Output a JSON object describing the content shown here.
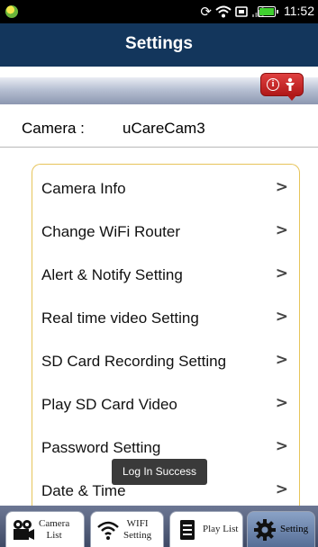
{
  "status_bar": {
    "time": "11:52",
    "icons": [
      "sync-icon",
      "wifi-icon",
      "screenshot-icon",
      "signal-icon",
      "battery-icon"
    ]
  },
  "header": {
    "title": "Settings"
  },
  "camera": {
    "label": "Camera :",
    "name": "uCareCam3"
  },
  "menu": {
    "items": [
      {
        "label": "Camera Info",
        "chevron": ">"
      },
      {
        "label": "Change WiFi Router",
        "chevron": ">"
      },
      {
        "label": "Alert & Notify Setting",
        "chevron": ">"
      },
      {
        "label": "Real time video Setting",
        "chevron": ">"
      },
      {
        "label": "SD Card Recording Setting",
        "chevron": ">"
      },
      {
        "label": "Play SD Card Video",
        "chevron": ">"
      },
      {
        "label": "Password Setting",
        "chevron": ">"
      },
      {
        "label": "Date & Time",
        "chevron": ">"
      }
    ]
  },
  "toast": {
    "text": "Log In Success"
  },
  "tabs": [
    {
      "line1": "Camera",
      "line2": "List",
      "icon": "camera-icon"
    },
    {
      "line1": "WIFI",
      "line2": "Setting",
      "icon": "wifi-icon"
    },
    {
      "line1": "Play List",
      "line2": "",
      "icon": "document-icon"
    },
    {
      "line1": "Setting",
      "line2": "",
      "icon": "gear-icon",
      "active": true
    }
  ],
  "colors": {
    "header_bg": "#13365c",
    "card_border": "#e7c45a",
    "badge_red": "#d02828"
  }
}
